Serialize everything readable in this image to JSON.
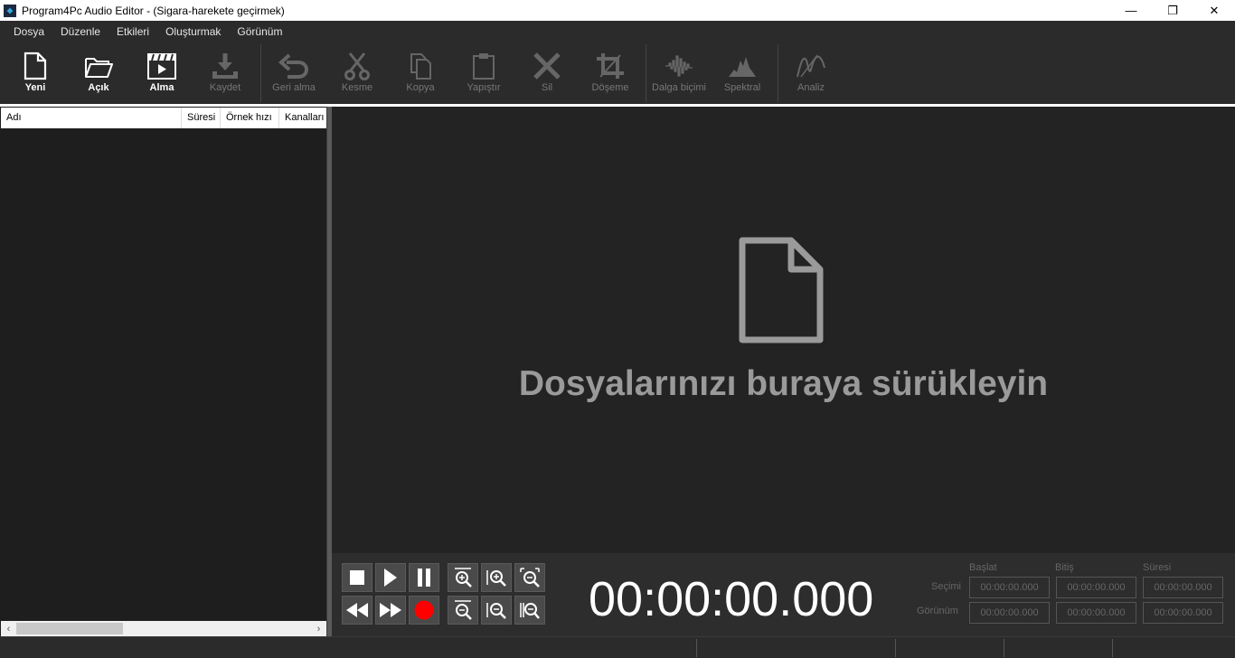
{
  "window": {
    "title": "Program4Pc Audio Editor - (Sigara-harekete geçirmek)",
    "minimize": "—",
    "maximize": "❐",
    "close": "✕"
  },
  "menu": [
    "Dosya",
    "Düzenle",
    "Etkileri",
    "Oluşturmak",
    "Görünüm"
  ],
  "toolbar": {
    "new": "Yeni",
    "open": "Açık",
    "import": "Alma",
    "save": "Kaydet",
    "undo": "Geri alma",
    "cut": "Kesme",
    "copy": "Kopya",
    "paste": "Yapıştır",
    "delete": "Sil",
    "trim": "Döşeme",
    "waveform": "Dalga biçimi",
    "spectral": "Spektral",
    "analyze": "Analiz"
  },
  "file_list": {
    "columns": [
      "Adı",
      "Süresi",
      "Örnek hızı",
      "Kanalları"
    ]
  },
  "drop_zone": {
    "text": "Dosyalarınızı buraya sürükleyin"
  },
  "player": {
    "time": "00:00:00.000",
    "headers": [
      "Başlat",
      "Bitiş",
      "Süresi"
    ],
    "selection_label": "Seçimi",
    "view_label": "Görünüm",
    "selection": [
      "00:00:00.000",
      "00:00:00.000",
      "00:00:00.000"
    ],
    "view": [
      "00:00:00.000",
      "00:00:00.000",
      "00:00:00.000"
    ]
  },
  "colors": {
    "record": "#ff0000",
    "background": "#1e1e1e",
    "panel": "#2b2b2b"
  }
}
